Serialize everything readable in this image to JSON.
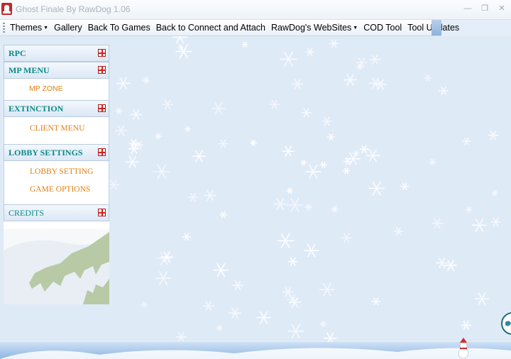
{
  "window": {
    "title": "Ghost Finale By RawDog 1.06",
    "controls": {
      "minimize": "—",
      "maximize": "❐",
      "close": "✕"
    }
  },
  "menubar": {
    "items": [
      {
        "label": "Themes",
        "dropdown": true
      },
      {
        "label": "Gallery",
        "dropdown": false
      },
      {
        "label": "Back To Games",
        "dropdown": false
      },
      {
        "label": "Back to Connect and Attach",
        "dropdown": false
      },
      {
        "label": "RawDog's WebSites",
        "dropdown": true
      },
      {
        "label": "COD Tool",
        "dropdown": false
      },
      {
        "label": "Tool Updates",
        "dropdown": false
      }
    ],
    "caret": "▼"
  },
  "sidebar": {
    "sections": [
      {
        "title": "RPC",
        "items": []
      },
      {
        "title": "MP MENU",
        "items": [
          "MP ZONE"
        ]
      },
      {
        "title": "EXTINCTION",
        "items": [
          "CLIENT MENU"
        ]
      },
      {
        "title": "LOBBY SETTINGS",
        "items": [
          "LOBBY SETTING",
          "GAME OPTIONS"
        ]
      },
      {
        "title": "CREDITS",
        "items": []
      }
    ],
    "section_icon": "gift-icon"
  },
  "colors": {
    "section_title": "#0c8a8a",
    "link": "#e07f13",
    "background": "#dfeaf7"
  }
}
